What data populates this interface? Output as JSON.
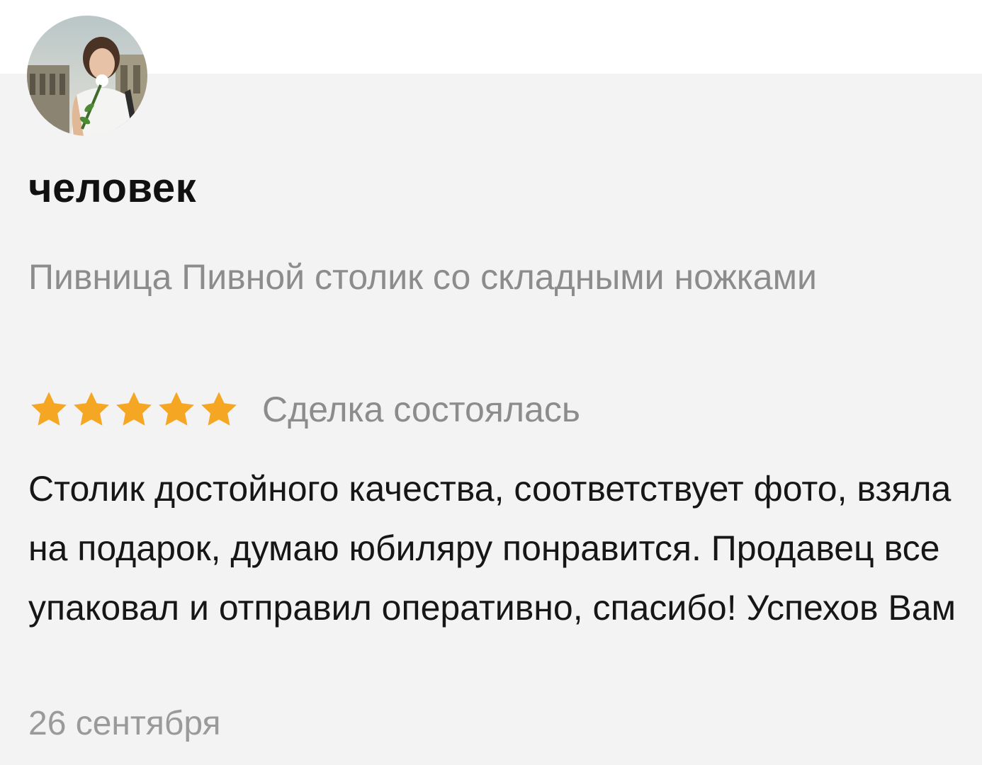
{
  "review": {
    "author": "человек",
    "product": "Пивница Пивной столик со складными ножками",
    "rating": 5,
    "rating_max": 5,
    "deal_status": "Сделка состоялась",
    "text": "Столик достойного качества, соответствует фото, взяла на подарок, думаю юбиляру понравится. Продавец все упаковал и отправил оперативно, спасибо! Успехов Вам",
    "date": "26 сентября"
  },
  "colors": {
    "card_background": "#f3f3f3",
    "star": "#f5a623",
    "author_text": "#111111",
    "secondary_text": "#8c8c8c",
    "body_text": "#161616"
  },
  "icons": {
    "star": "star-icon",
    "avatar": "user-photo"
  }
}
